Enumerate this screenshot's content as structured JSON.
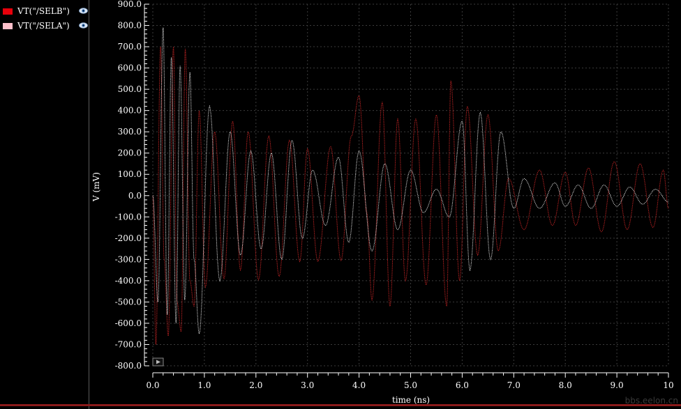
{
  "legend": {
    "items": [
      {
        "label": "VT(\"/SELB\")",
        "color": "#e8000b",
        "icon": "eye-icon"
      },
      {
        "label": "VT(\"/SELA\")",
        "color": "#ffc0cb",
        "icon": "eye-icon"
      }
    ]
  },
  "watermark": "bbs.eelon.cn",
  "chart_data": {
    "type": "line",
    "title": "",
    "xlabel": "time (ns)",
    "ylabel": "V (mV)",
    "xlim": [
      0,
      10
    ],
    "ylim": [
      -800,
      900
    ],
    "xticks": [
      "0.0",
      "1.0",
      "2.0",
      "3.0",
      "4.0",
      "5.0",
      "6.0",
      "7.0",
      "8.0",
      "9.0",
      "10"
    ],
    "yticks": [
      "900.0",
      "800.0",
      "700.0",
      "600.0",
      "500.0",
      "400.0",
      "300.0",
      "200.0",
      "100.0",
      "0.0",
      "-100.0",
      "-200.0",
      "-300.0",
      "-400.0",
      "-500.0",
      "-600.0",
      "-700.0",
      "-800.0"
    ],
    "grid": true,
    "series": [
      {
        "name": "VT(\"/SELB\")",
        "color": "#b02020",
        "x": [
          0.0,
          0.06,
          0.15,
          0.22,
          0.3,
          0.4,
          0.47,
          0.55,
          0.63,
          0.72,
          0.8,
          0.9,
          1.02,
          1.2,
          1.38,
          1.55,
          1.7,
          1.85,
          2.05,
          2.25,
          2.45,
          2.65,
          2.85,
          3.0,
          3.2,
          3.45,
          3.65,
          3.85,
          4.0,
          4.15,
          4.25,
          4.45,
          4.6,
          4.75,
          4.9,
          5.1,
          5.3,
          5.5,
          5.7,
          5.78,
          5.95,
          6.1,
          6.3,
          6.5,
          6.7,
          6.9,
          7.2,
          7.5,
          7.75,
          8.0,
          8.2,
          8.45,
          8.7,
          8.95,
          9.2,
          9.45,
          9.7,
          9.9,
          10.0
        ],
        "y": [
          0,
          -700,
          700,
          -300,
          -660,
          700,
          -500,
          -640,
          690,
          -400,
          -520,
          400,
          -430,
          300,
          -390,
          350,
          -350,
          300,
          -395,
          280,
          -380,
          260,
          -310,
          220,
          -310,
          230,
          -305,
          280,
          470,
          -80,
          -490,
          440,
          -520,
          360,
          -400,
          360,
          -420,
          380,
          -520,
          540,
          -400,
          420,
          -280,
          380,
          -260,
          80,
          -160,
          120,
          -140,
          110,
          -140,
          130,
          -170,
          160,
          -160,
          150,
          -150,
          120,
          -60
        ]
      },
      {
        "name": "VT(\"/SELA\")",
        "color": "#ffffff",
        "x": [
          0.0,
          0.1,
          0.2,
          0.28,
          0.36,
          0.45,
          0.53,
          0.62,
          0.72,
          0.8,
          0.9,
          1.1,
          1.3,
          1.5,
          1.7,
          1.9,
          2.1,
          2.3,
          2.5,
          2.7,
          2.9,
          3.1,
          3.35,
          3.6,
          3.8,
          4.0,
          4.25,
          4.5,
          4.75,
          5.0,
          5.25,
          5.5,
          5.75,
          6.0,
          6.15,
          6.35,
          6.55,
          6.75,
          7.0,
          7.2,
          7.5,
          7.8,
          8.0,
          8.25,
          8.5,
          8.75,
          9.0,
          9.25,
          9.5,
          9.75,
          10.0
        ],
        "y": [
          0,
          -500,
          790,
          -560,
          650,
          -600,
          610,
          -490,
          580,
          -300,
          -650,
          420,
          -400,
          300,
          -280,
          210,
          -250,
          200,
          -300,
          260,
          -200,
          120,
          -140,
          180,
          -220,
          210,
          -260,
          150,
          -160,
          120,
          -80,
          30,
          -100,
          350,
          -350,
          390,
          -300,
          300,
          -60,
          80,
          -60,
          60,
          -50,
          50,
          -60,
          50,
          -50,
          40,
          -40,
          30,
          -30
        ]
      }
    ]
  }
}
